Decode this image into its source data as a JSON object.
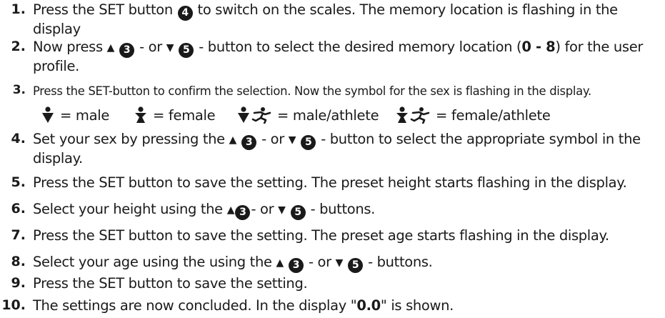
{
  "steps": [
    {
      "number": "1.",
      "parts": [
        {
          "t": "Press the SET button "
        },
        {
          "c": "4"
        },
        {
          "t": " to switch on the scales. The memory location is flashing in the display"
        }
      ]
    },
    {
      "number": "2.",
      "parts": [
        {
          "t": "Now press "
        },
        {
          "tri": "▲"
        },
        {
          "t": " "
        },
        {
          "c": "3"
        },
        {
          "t": " - or "
        },
        {
          "tri": "▼"
        },
        {
          "t": " "
        },
        {
          "c": "5"
        },
        {
          "t": " - button to select the desired memory location ("
        },
        {
          "b": "0 - 8"
        },
        {
          "t": ") for the user profile."
        }
      ]
    },
    {
      "number": "3.",
      "small": true,
      "parts": [
        {
          "t": "Press the SET-button to confirm the selection. Now the symbol for the sex is flashing in the display."
        }
      ]
    },
    {
      "number": "4.",
      "parts": [
        {
          "t": "Set your sex by pressing the "
        },
        {
          "tri": "▲"
        },
        {
          "t": " "
        },
        {
          "c": "3"
        },
        {
          "t": " - or "
        },
        {
          "tri": "▼"
        },
        {
          "t": " "
        },
        {
          "c": "5"
        },
        {
          "t": " - button to select the appropriate symbol in the display."
        }
      ]
    },
    {
      "number": "5.",
      "parts": [
        {
          "t": "Press the SET button to save the setting. The preset height starts flashing in the display."
        }
      ]
    },
    {
      "number": "6.",
      "parts": [
        {
          "t": "Select your height using the "
        },
        {
          "tri": "▲"
        },
        {
          "c": "3"
        },
        {
          "t": "- or "
        },
        {
          "tri": "▼"
        },
        {
          "t": " "
        },
        {
          "c": "5"
        },
        {
          "t": " - buttons."
        }
      ]
    },
    {
      "number": "7.",
      "parts": [
        {
          "t": "Press the SET button to save the setting. The preset age starts flashing in the display."
        }
      ]
    },
    {
      "number": "8.",
      "parts": [
        {
          "t": "Select your age using the using the "
        },
        {
          "tri": "▲"
        },
        {
          "t": " "
        },
        {
          "c": "3"
        },
        {
          "t": " - or "
        },
        {
          "tri": "▼"
        },
        {
          "t": " "
        },
        {
          "c": "5"
        },
        {
          "t": " - buttons."
        }
      ]
    },
    {
      "number": "9.",
      "parts": [
        {
          "t": "Press the SET button to save the setting."
        }
      ]
    },
    {
      "number": "10.",
      "parts": [
        {
          "t": "The settings are now concluded. In the display \""
        },
        {
          "b": "0.0"
        },
        {
          "t": "\" is shown."
        }
      ]
    }
  ],
  "legend": [
    {
      "icon": "male-icon",
      "label": "= male"
    },
    {
      "icon": "female-icon",
      "label": "= female"
    },
    {
      "icon": "male-athlete-icon",
      "label": "= male/athlete"
    },
    {
      "icon": "female-athlete-icon",
      "label": "= female/athlete"
    }
  ],
  "colors": {
    "text": "#1a1a1a",
    "badge_bg": "#1a1a1a",
    "badge_text": "#ffffff"
  }
}
